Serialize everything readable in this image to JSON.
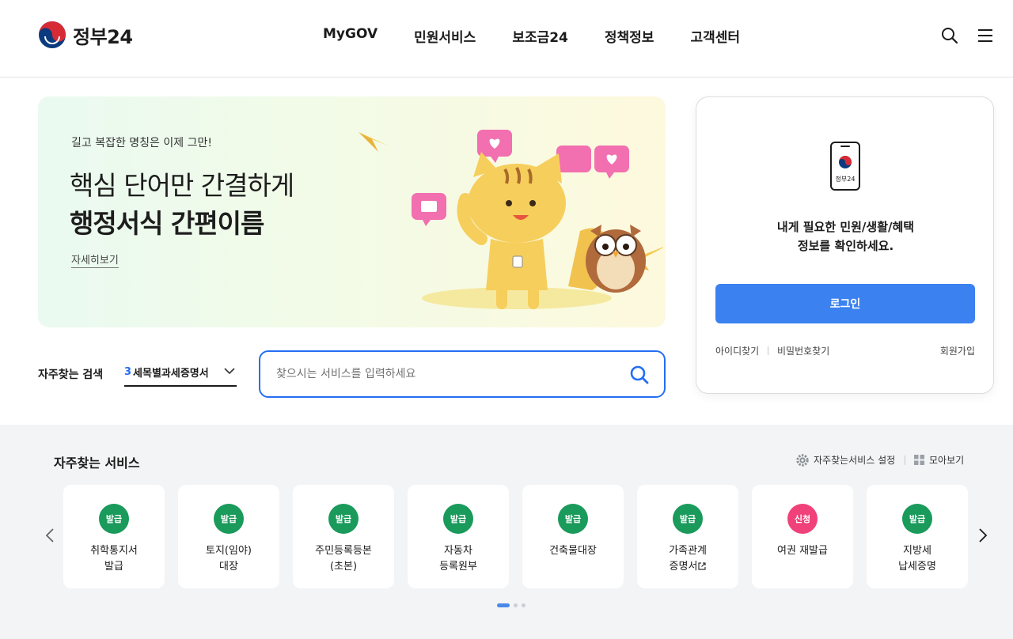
{
  "header": {
    "logo_text": "정부24",
    "nav": [
      "MyGOV",
      "민원서비스",
      "보조금24",
      "정책정보",
      "고객센터"
    ],
    "icons": [
      "search-icon",
      "hamburger-menu-icon"
    ]
  },
  "banner": {
    "eyebrow": "길고 복잡한 명칭은 이제 그만!",
    "title_line1": "핵심 단어만 간결하게",
    "title_line2": "행정서식 간편이름",
    "more_link": "자세히보기"
  },
  "search": {
    "label": "자주찾는 검색",
    "select_rank": "3",
    "select_value": "세목별과세증명서",
    "placeholder": "찾으시는 서비스를 입력하세요"
  },
  "login": {
    "phone_logo_text": "정부24",
    "message_line1": "내게 필요한 민원/생활/혜택",
    "message_line2": "정보를 확인하세요.",
    "button_label": "로그인",
    "find_id": "아이디찾기",
    "find_pw": "비밀번호찾기",
    "signup": "회원가입"
  },
  "services": {
    "title": "자주찾는 서비스",
    "settings_label": "자주찾는서비스 설정",
    "view_all_label": "모아보기",
    "colors": {
      "issue": "#1a9a5b",
      "apply": "#f0417a"
    },
    "items": [
      {
        "badge": "발급",
        "type": "issue",
        "label": "취학통지서\n발급"
      },
      {
        "badge": "발급",
        "type": "issue",
        "label": "토지(임야)\n대장"
      },
      {
        "badge": "발급",
        "type": "issue",
        "label": "주민등록등본\n(초본)"
      },
      {
        "badge": "발급",
        "type": "issue",
        "label": "자동차\n등록원부"
      },
      {
        "badge": "발급",
        "type": "issue",
        "label": "건축물대장"
      },
      {
        "badge": "발급",
        "type": "issue",
        "label": "가족관계\n증명서"
      },
      {
        "badge": "신청",
        "type": "apply",
        "label": "여권 재발급"
      },
      {
        "badge": "발급",
        "type": "issue",
        "label": "지방세\n납세증명"
      }
    ]
  },
  "colors": {
    "accent": "#256ef4",
    "login_button": "#3b82f0"
  }
}
